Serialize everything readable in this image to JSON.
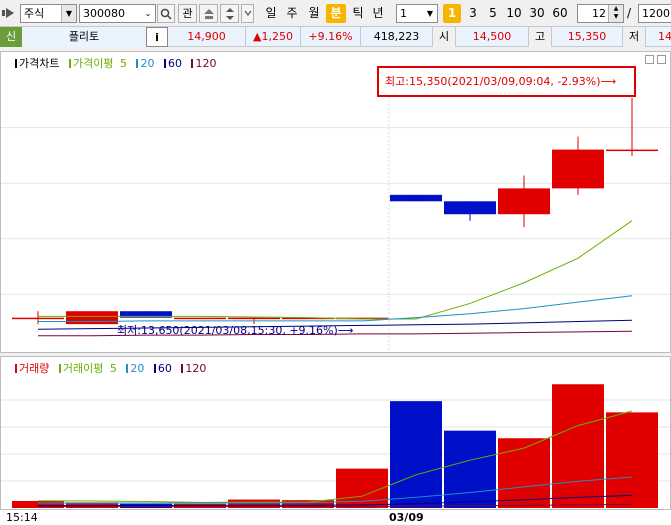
{
  "toolbar": {
    "market": "주식",
    "code": "300080",
    "btn_gwan": "관",
    "periods": [
      "일",
      "주",
      "월",
      "분",
      "틱",
      "년"
    ],
    "active_period": "분",
    "interval": "1",
    "interval_badge": "1",
    "quick_intervals": [
      "3",
      "5",
      "10",
      "30",
      "60"
    ],
    "view_count": "12",
    "slash": "/",
    "total_count": "1200"
  },
  "quote": {
    "badge": "신",
    "name": "플리토",
    "info": "i",
    "price": "14,900",
    "change": "▲1,250",
    "change_pct": "+9.16%",
    "volume": "418,223",
    "open_label": "시",
    "open": "14,500",
    "high_label": "고",
    "high": "15,350",
    "low_label": "저",
    "low": "14"
  },
  "price_legend": {
    "main": "가격차트",
    "ma_label": "가격이평",
    "ma": [
      "5",
      "20",
      "60",
      "120"
    ]
  },
  "volume_legend": {
    "main": "거래량",
    "ma_label": "거래이평",
    "ma": [
      "5",
      "20",
      "60",
      "120"
    ]
  },
  "annotations": {
    "high": "최고:15,350(2021/03/09,09:04, -2.93%)⟶",
    "low": "최저:13,650(2021/03/08,15:30, +9.16%)⟶"
  },
  "xaxis": {
    "left": "15:14",
    "date": "03/09"
  },
  "colors": {
    "up": "#e00000",
    "down": "#0010c8",
    "ma5": "#6bb000",
    "ma20": "#1e90c8",
    "ma60": "#000080",
    "ma120": "#800040"
  },
  "chart_data": {
    "type": "candlestick",
    "candles": [
      {
        "o": 13650,
        "h": 13700,
        "l": 13600,
        "c": 13650
      },
      {
        "o": 13600,
        "h": 13700,
        "l": 13600,
        "c": 13700
      },
      {
        "o": 13700,
        "h": 13700,
        "l": 13650,
        "c": 13650
      },
      {
        "o": 13650,
        "h": 13650,
        "l": 13650,
        "c": 13650
      },
      {
        "o": 13650,
        "h": 13650,
        "l": 13600,
        "c": 13650
      },
      {
        "o": 13650,
        "h": 13650,
        "l": 13650,
        "c": 13650
      },
      {
        "o": 13650,
        "h": 13650,
        "l": 13650,
        "c": 13650
      },
      {
        "o": 14600,
        "h": 14600,
        "l": 14550,
        "c": 14550
      },
      {
        "o": 14550,
        "h": 14550,
        "l": 14400,
        "c": 14450
      },
      {
        "o": 14450,
        "h": 14750,
        "l": 14350,
        "c": 14650
      },
      {
        "o": 14650,
        "h": 15050,
        "l": 14600,
        "c": 14950
      },
      {
        "o": 14950,
        "h": 15350,
        "l": 14900,
        "c": 14950
      }
    ],
    "ma5": [
      13660,
      13660,
      13660,
      13660,
      13655,
      13650,
      13640,
      13640,
      13760,
      13920,
      14110,
      14400
    ],
    "ma20": [
      13620,
      13620,
      13625,
      13625,
      13625,
      13625,
      13625,
      13650,
      13680,
      13720,
      13770,
      13820
    ],
    "ma60": [
      13560,
      13565,
      13570,
      13575,
      13580,
      13585,
      13590,
      13595,
      13600,
      13610,
      13620,
      13630
    ],
    "ma120": [
      13510,
      13510,
      13515,
      13515,
      13520,
      13520,
      13525,
      13525,
      13530,
      13535,
      13540,
      13545
    ],
    "volume": [
      2500,
      2000,
      1500,
      1500,
      3000,
      2800,
      14000,
      38000,
      27500,
      24800,
      44000,
      34000
    ],
    "vol_ma5": [
      2600,
      2500,
      2300,
      2000,
      2100,
      2100,
      4200,
      11800,
      17000,
      21300,
      29300,
      34500
    ],
    "vol_ma20": [
      1800,
      1800,
      1800,
      1800,
      1800,
      1900,
      2400,
      3800,
      5500,
      7500,
      9500,
      11000
    ],
    "vol_ma60": [
      900,
      900,
      950,
      950,
      1000,
      1000,
      1100,
      1500,
      2200,
      2900,
      3800,
      4500
    ],
    "vol_ma120": [
      500,
      500,
      500,
      500,
      520,
      520,
      550,
      650,
      800,
      950,
      1100,
      1300
    ],
    "price_range": [
      13400,
      15550
    ],
    "volume_range": [
      0,
      48000
    ]
  }
}
